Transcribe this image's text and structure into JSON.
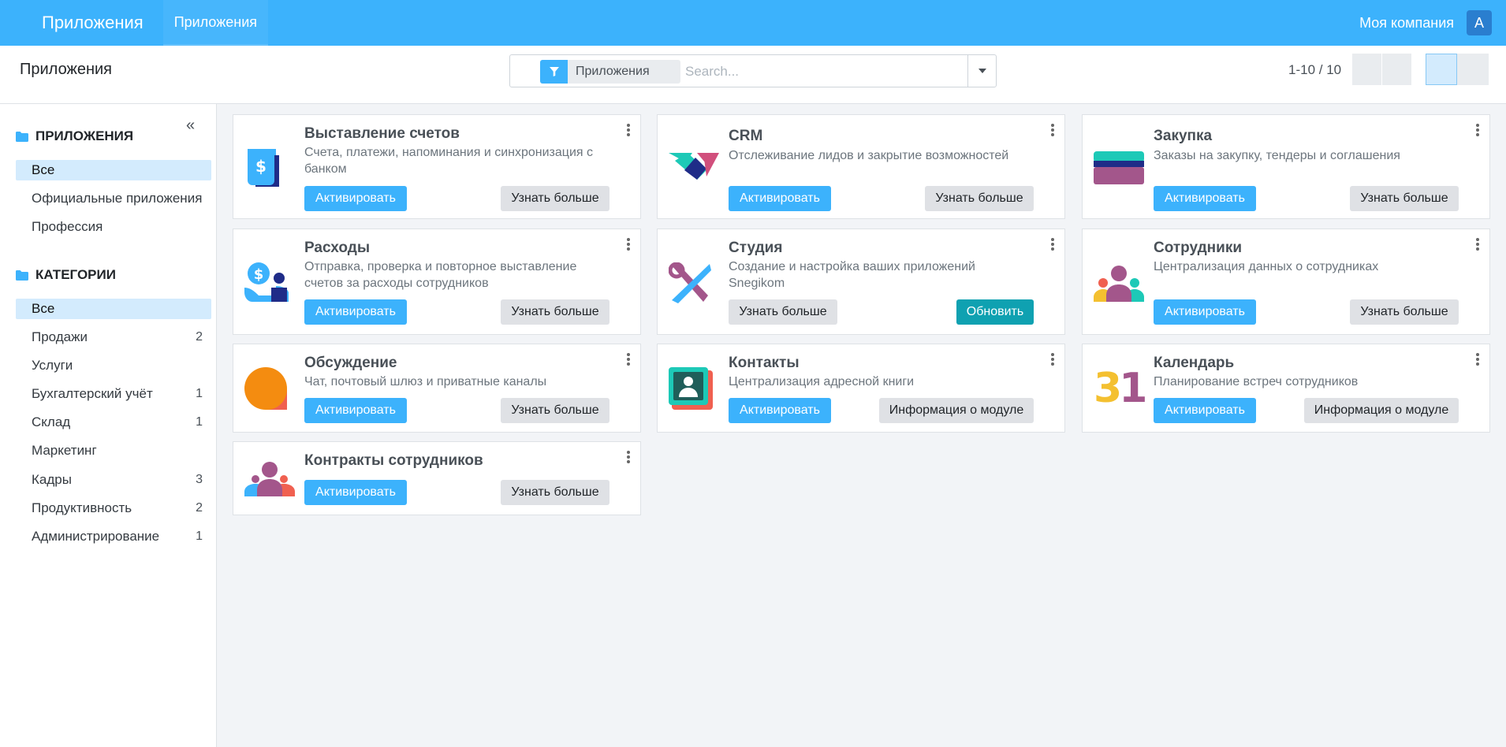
{
  "navbar": {
    "brand": "Приложения",
    "menu": "Приложения",
    "company": "Моя компания",
    "avatar": "A"
  },
  "control": {
    "title": "Приложения",
    "facet": "Приложения",
    "search_placeholder": "Search...",
    "pager": "1-10 / 10"
  },
  "sidebar": {
    "apps_heading": "ПРИЛОЖЕНИЯ",
    "apps": [
      {
        "label": "Все",
        "active": true
      },
      {
        "label": "Официальные приложения"
      },
      {
        "label": "Профессия"
      }
    ],
    "cat_heading": "КАТЕГОРИИ",
    "categories": [
      {
        "label": "Все",
        "count": "",
        "active": true
      },
      {
        "label": "Продажи",
        "count": "2"
      },
      {
        "label": "Услуги",
        "count": ""
      },
      {
        "label": "Бухгалтерский учёт",
        "count": "1"
      },
      {
        "label": "Склад",
        "count": "1"
      },
      {
        "label": "Маркетинг",
        "count": ""
      },
      {
        "label": "Кадры",
        "count": "3"
      },
      {
        "label": "Продуктивность",
        "count": "2"
      },
      {
        "label": "Администрирование",
        "count": "1"
      }
    ]
  },
  "cards": [
    {
      "title": "Выставление счетов",
      "desc1": "Счета, платежи, напоминания и синхронизация с",
      "desc2": "банком",
      "primary": "Активировать",
      "secondary": "Узнать больше",
      "icon": "invoicing-icon"
    },
    {
      "title": "CRM",
      "desc1": "Отслеживание лидов и закрытие возможностей",
      "desc2": "",
      "primary": "Активировать",
      "secondary": "Узнать больше",
      "icon": "crm-icon"
    },
    {
      "title": "Закупка",
      "desc1": "Заказы на закупку, тендеры и соглашения",
      "desc2": "",
      "primary": "Активировать",
      "secondary": "Узнать больше",
      "icon": "purchase-icon"
    },
    {
      "title": "Расходы",
      "desc1": "Отправка, проверка и повторное выставление",
      "desc2": "счетов за расходы сотрудников",
      "primary": "Активировать",
      "secondary": "Узнать больше",
      "icon": "expenses-icon"
    },
    {
      "title": "Студия",
      "desc1": "Создание и настройка ваших приложений",
      "desc2": "Snegikom",
      "primary": "Узнать больше",
      "secondary": "Обновить",
      "icon": "studio-icon"
    },
    {
      "title": "Сотрудники",
      "desc1": "Централизация данных о сотрудниках",
      "desc2": "",
      "primary": "Активировать",
      "secondary": "Узнать больше",
      "icon": "employees-icon"
    },
    {
      "title": "Обсуждение",
      "desc1": "Чат, почтовый шлюз и приватные каналы",
      "desc2": "",
      "primary": "Активировать",
      "secondary": "Узнать больше",
      "icon": "discuss-icon"
    },
    {
      "title": "Контакты",
      "desc1": "Централизация адресной книги",
      "desc2": "",
      "primary": "Активировать",
      "secondary": "Информация о модуле",
      "icon": "contacts-icon"
    },
    {
      "title": "Календарь",
      "desc1": "Планирование встреч сотрудников",
      "desc2": "",
      "primary": "Активировать",
      "secondary": "Информация о модуле",
      "icon": "calendar-icon",
      "icon_text": "31"
    },
    {
      "title": "Контракты сотрудников",
      "desc1": "",
      "desc2": "",
      "primary": "Активировать",
      "secondary": "Узнать больше",
      "icon": "contracts-icon"
    }
  ],
  "colors": {
    "primary": "#3cb2fc",
    "update": "#0fa1b1",
    "active_bg": "#d3ebfd"
  }
}
